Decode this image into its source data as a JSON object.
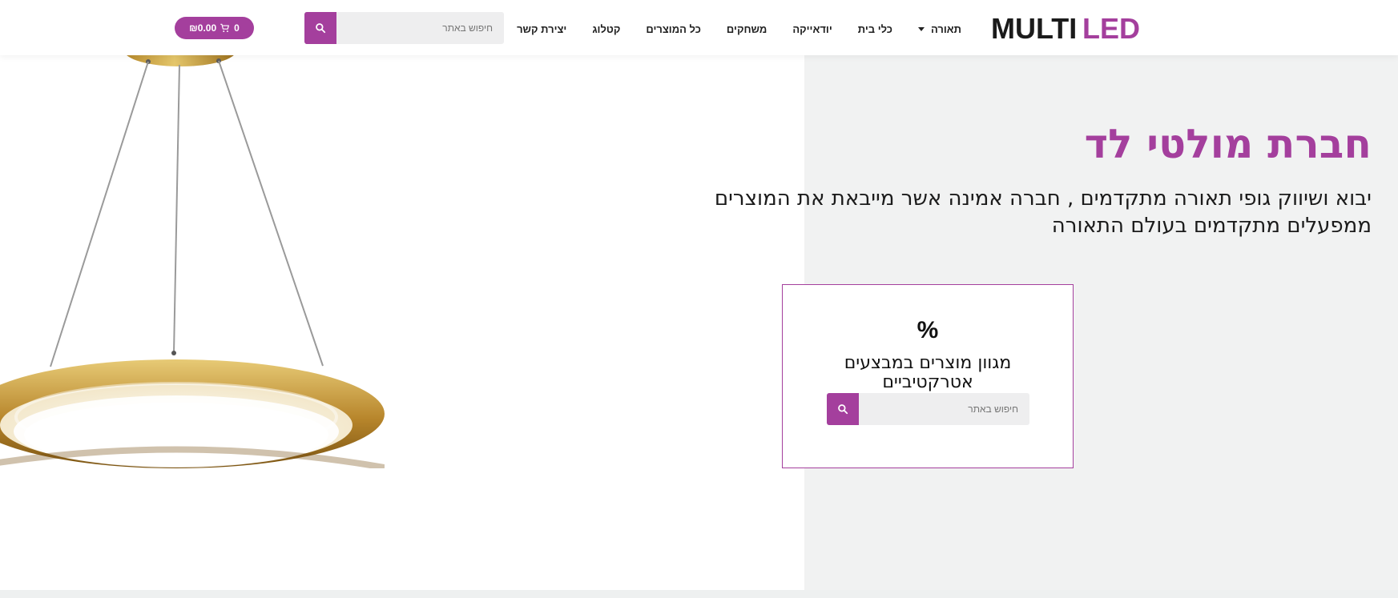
{
  "header": {
    "logo_text": "MULTILED",
    "nav": [
      {
        "label": "תאורה",
        "has_dropdown": true
      },
      {
        "label": "כלי בית"
      },
      {
        "label": "יודאייקה"
      },
      {
        "label": "משחקים"
      },
      {
        "label": "כל המוצרים"
      },
      {
        "label": "קטלוג"
      },
      {
        "label": "יצירת קשר"
      }
    ],
    "search": {
      "placeholder": "חיפוש באתר",
      "icon": "search-icon"
    },
    "cart": {
      "count": "0",
      "amount": "₪0.00",
      "icon": "cart-icon"
    }
  },
  "hero": {
    "title": "חברת מולטי לד",
    "subtitle": "יבוא ושיווק גופי תאורה מתקדמים , חברה אמינה אשר מייבאת את המוצרים ממפעלים מתקדמים בעולם התאורה"
  },
  "promo": {
    "icon_label": "%",
    "text": "מגוון מוצרים במבצעים אטרקטיביים",
    "search": {
      "placeholder": "חיפוש באתר",
      "icon": "search-icon"
    }
  },
  "colors": {
    "brand": "#a43f9d",
    "hero_bg": "#f1f2f2"
  }
}
